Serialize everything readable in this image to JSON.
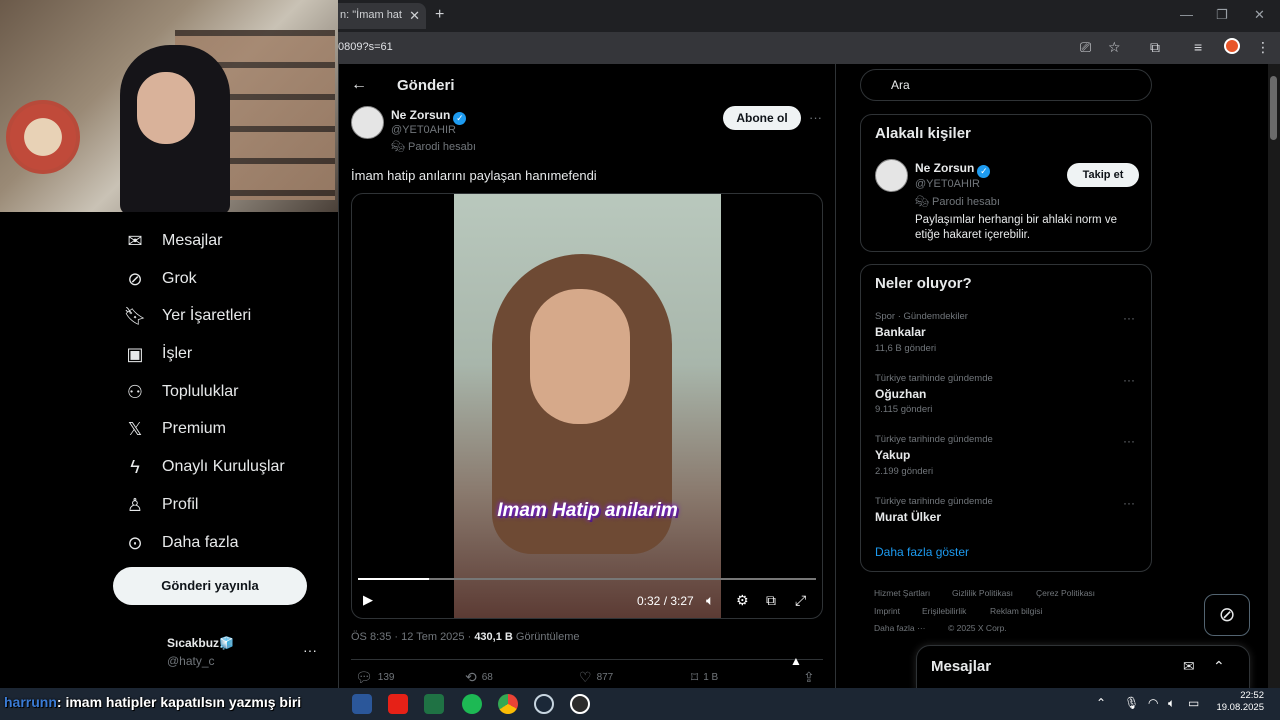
{
  "browser": {
    "tab_title": "n: \"İmam hat",
    "url": "0809?s=61"
  },
  "nav": {
    "items": [
      {
        "label": "Mesajlar",
        "icon": "mail-icon"
      },
      {
        "label": "Grok",
        "icon": "grok-icon"
      },
      {
        "label": "Yer İşaretleri",
        "icon": "bookmark-icon"
      },
      {
        "label": "İşler",
        "icon": "briefcase-icon"
      },
      {
        "label": "Topluluklar",
        "icon": "people-icon"
      },
      {
        "label": "Premium",
        "icon": "x-logo-icon"
      },
      {
        "label": "Onaylı Kuruluşlar",
        "icon": "lightning-icon"
      },
      {
        "label": "Profil",
        "icon": "person-icon"
      },
      {
        "label": "Daha fazla",
        "icon": "more-circle-icon"
      }
    ],
    "post_button": "Gönderi yayınla",
    "account": {
      "name": "Sıcakbuz🧊",
      "handle": "@haty_c"
    }
  },
  "post": {
    "header_title": "Gönderi",
    "author_name": "Ne Zorsun",
    "author_handle": "@YET0AHIR",
    "parody_label": "Parodi hesabı",
    "subscribe": "Abone ol",
    "text": "İmam hatip anılarını paylaşan hanımefendi",
    "video": {
      "caption": "Imam Hatip anilarim",
      "time": "0:32 / 3:27",
      "progress": 0.155
    },
    "meta": {
      "time": "ÖS 8:35 · 12 Tem 2025 · ",
      "views": "430,1 B",
      "views_label": " Görüntüleme"
    },
    "actions": {
      "replies": "139",
      "reposts": "68",
      "likes": "877",
      "bookmarks": "1 B"
    }
  },
  "sidebar": {
    "search_placeholder": "Ara",
    "relevant": {
      "title": "Alakalı kişiler",
      "name": "Ne Zorsun",
      "handle": "@YET0AHIR",
      "parody": "Parodi hesabı",
      "bio": "Paylaşımlar herhangi bir ahlaki norm ve etiğe hakaret içerebilir.",
      "follow": "Takip et"
    },
    "trends": {
      "title": "Neler oluyor?",
      "items": [
        {
          "category": "Spor · Gündemdekiler",
          "name": "Bankalar",
          "count": "11,6 B gönderi"
        },
        {
          "category": "Türkiye tarihinde gündemde",
          "name": "Oğuzhan",
          "count": "9.115 gönderi"
        },
        {
          "category": "Türkiye tarihinde gündemde",
          "name": "Yakup",
          "count": "2.199 gönderi"
        },
        {
          "category": "Türkiye tarihinde gündemde",
          "name": "Murat Ülker",
          "count": ""
        }
      ],
      "show_more": "Daha fazla göster"
    },
    "footer": {
      "links": [
        "Hizmet Şartları",
        "Gizlilik Politikası",
        "Çerez Politikası",
        "Imprint",
        "Erişilebilirlik",
        "Reklam bilgisi",
        "Daha fazla ···",
        "© 2025 X Corp."
      ]
    },
    "messages_dock": "Mesajlar"
  },
  "overlay": {
    "chat_nick": "harrunn",
    "chat_text": ": imam hatipler kapatılsın yazmış biri"
  },
  "taskbar": {
    "time": "22:52",
    "date": "19.08.2025"
  },
  "colors": {
    "accent": "#1d9bf0",
    "background": "#000000",
    "border": "#2f3336",
    "muted": "#71767b"
  }
}
